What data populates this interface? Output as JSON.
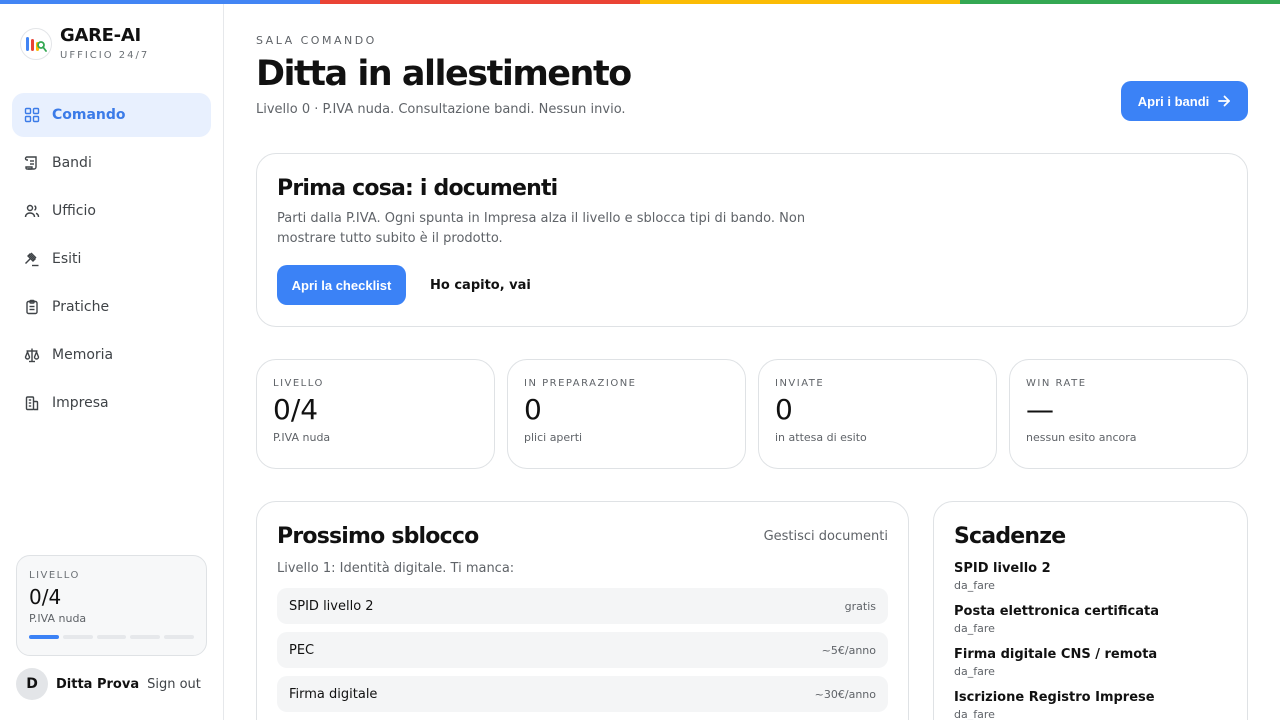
{
  "colors": {
    "accent": "#3b82f6",
    "active_bg": "#e8f0fe",
    "topbar": [
      "#4285f4",
      "#ea4335",
      "#fbbc05",
      "#34a853"
    ]
  },
  "brand": {
    "title": "GARE-AI",
    "subtitle": "UFFICIO 24/7"
  },
  "sidebar": {
    "items": [
      {
        "label": "Comando",
        "icon": "grid-icon",
        "active": true
      },
      {
        "label": "Bandi",
        "icon": "scroll-icon"
      },
      {
        "label": "Ufficio",
        "icon": "users-icon"
      },
      {
        "label": "Esiti",
        "icon": "gavel-icon"
      },
      {
        "label": "Pratiche",
        "icon": "clipboard-icon"
      },
      {
        "label": "Memoria",
        "icon": "scale-icon"
      },
      {
        "label": "Impresa",
        "icon": "building-icon"
      }
    ],
    "level_card": {
      "label": "LIVELLO",
      "value": "0/4",
      "sub": "P.IVA nuda",
      "progress": 0.2
    }
  },
  "user": {
    "initial": "D",
    "name": "Ditta Prova",
    "signout": "Sign out"
  },
  "header": {
    "eyebrow": "SALA COMANDO",
    "title": "Ditta in allestimento",
    "subtitle": "Livello 0 · P.IVA nuda. Consultazione bandi. Nessun invio.",
    "open_button": "Apri i bandi"
  },
  "docs_card": {
    "title": "Prima cosa: i documenti",
    "text": "Parti dalla P.IVA. Ogni spunta in Impresa alza il livello e sblocca tipi di bando. Non mostrare tutto subito è il prodotto.",
    "primary": "Apri la checklist",
    "secondary": "Ho capito, vai"
  },
  "stats": [
    {
      "label": "LIVELLO",
      "value": "0/4",
      "sub": "P.IVA nuda"
    },
    {
      "label": "IN PREPARAZIONE",
      "value": "0",
      "sub": "plici aperti"
    },
    {
      "label": "INVIATE",
      "value": "0",
      "sub": "in attesa di esito"
    },
    {
      "label": "WIN RATE",
      "value": "—",
      "sub": "nessun esito ancora"
    }
  ],
  "unlock": {
    "title": "Prossimo sblocco",
    "manage": "Gestisci documenti",
    "subtitle": "Livello 1: Identità digitale. Ti manca:",
    "items": [
      {
        "name": "SPID livello 2",
        "cost": "gratis"
      },
      {
        "name": "PEC",
        "cost": "~5€/anno"
      },
      {
        "name": "Firma digitale",
        "cost": "~30€/anno"
      }
    ]
  },
  "deadlines": {
    "title": "Scadenze",
    "items": [
      {
        "name": "SPID livello 2",
        "status": "da_fare"
      },
      {
        "name": "Posta elettronica certificata",
        "status": "da_fare"
      },
      {
        "name": "Firma digitale CNS / remota",
        "status": "da_fare"
      },
      {
        "name": "Iscrizione Registro Imprese",
        "status": "da_fare"
      }
    ]
  }
}
